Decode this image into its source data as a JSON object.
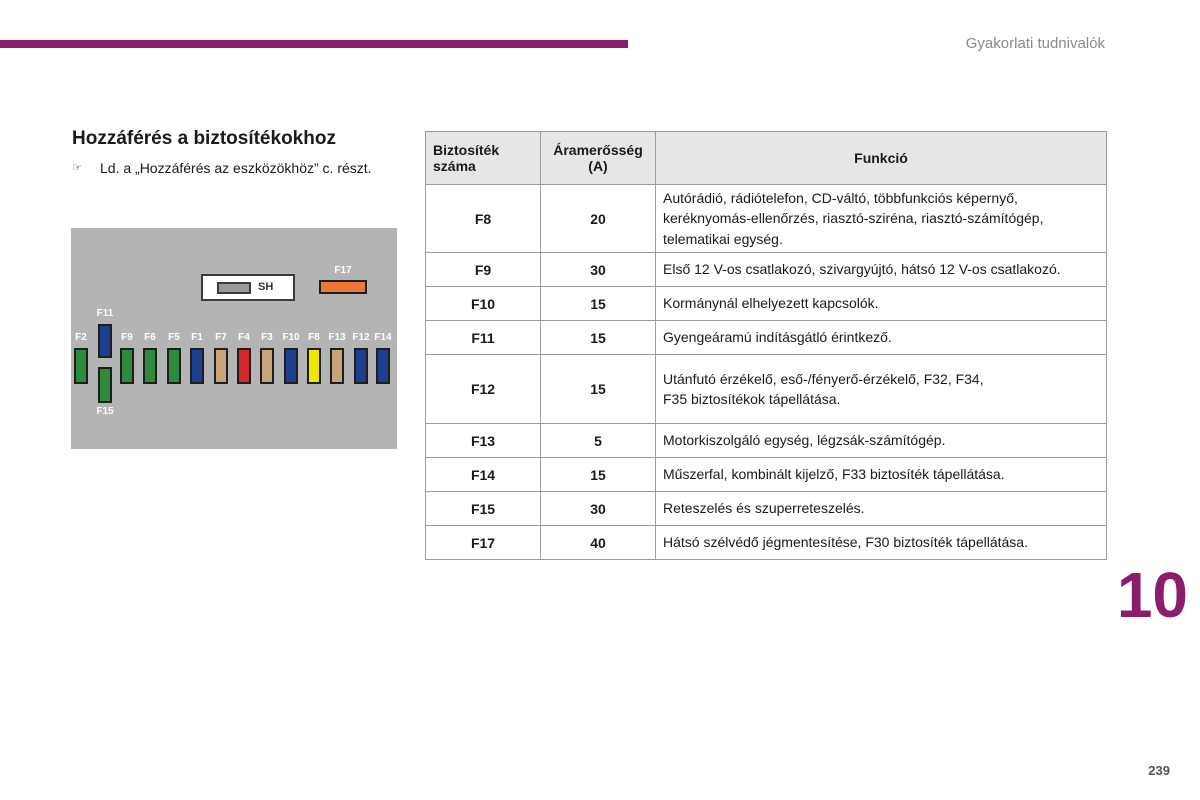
{
  "header": {
    "title": "Gyakorlati tudnivalók"
  },
  "section": {
    "title": "Hozzáférés a biztosítékokhoz",
    "bullet_symbol": "☞",
    "bullet_text": "Ld. a „Hozzáférés az eszközökhöz” c. részt."
  },
  "fuse_diagram": {
    "shunt_label": "SH",
    "fuses": [
      {
        "label": "F2",
        "color": "#2e8b3e"
      },
      {
        "label": "F11",
        "color": "#1e3f8f"
      },
      {
        "label": "F15",
        "color": "#2e8b3e"
      },
      {
        "label": "F9",
        "color": "#2e8b3e"
      },
      {
        "label": "F6",
        "color": "#2e8b3e"
      },
      {
        "label": "F5",
        "color": "#2e8b3e"
      },
      {
        "label": "F1",
        "color": "#1e3f8f"
      },
      {
        "label": "F7",
        "color": "#c9a37a"
      },
      {
        "label": "F4",
        "color": "#d62828"
      },
      {
        "label": "F3",
        "color": "#c9a37a"
      },
      {
        "label": "F10",
        "color": "#1e3f8f"
      },
      {
        "label": "F8",
        "color": "#f2e500"
      },
      {
        "label": "F13",
        "color": "#c9a37a"
      },
      {
        "label": "F12",
        "color": "#1e3f8f"
      },
      {
        "label": "F14",
        "color": "#1e3f8f"
      },
      {
        "label": "F17",
        "color": "#ee7733"
      }
    ]
  },
  "table": {
    "headers": [
      "Biztosíték\nszáma",
      "Áramerősség\n(A)",
      "Funkció"
    ],
    "rows": [
      {
        "fuse": "F8",
        "amps": "20",
        "function": "Autórádió, rádiótelefon, CD-váltó, többfunkciós képernyő,\nkeréknyomás-ellenőrzés, riasztó-sziréna, riasztó-számítógép,\ntelematikai egység."
      },
      {
        "fuse": "F9",
        "amps": "30",
        "function": "Első 12 V-os csatlakozó, szivargyújtó, hátsó 12 V-os csatlakozó."
      },
      {
        "fuse": "F10",
        "amps": "15",
        "function": "Kormánynál elhelyezett kapcsolók."
      },
      {
        "fuse": "F11",
        "amps": "15",
        "function": "Gyengeáramú indításgátló érintkező."
      },
      {
        "fuse": "F12",
        "amps": "15",
        "function": "Utánfutó érzékelő, eső-/fényerő-érzékelő, F32, F34,\nF35 biztosítékok tápellátása."
      },
      {
        "fuse": "F13",
        "amps": "5",
        "function": "Motorkiszolgáló egység, légzsák-számítógép."
      },
      {
        "fuse": "F14",
        "amps": "15",
        "function": "Műszerfal, kombinált kijelző, F33 biztosíték tápellátása."
      },
      {
        "fuse": "F15",
        "amps": "30",
        "function": "Reteszelés és szuperreteszelés."
      },
      {
        "fuse": "F17",
        "amps": "40",
        "function": "Hátsó szélvédő jégmentesítése, F30 biztosíték tápellátása."
      }
    ]
  },
  "chapter_number": "10",
  "page_number": "239"
}
